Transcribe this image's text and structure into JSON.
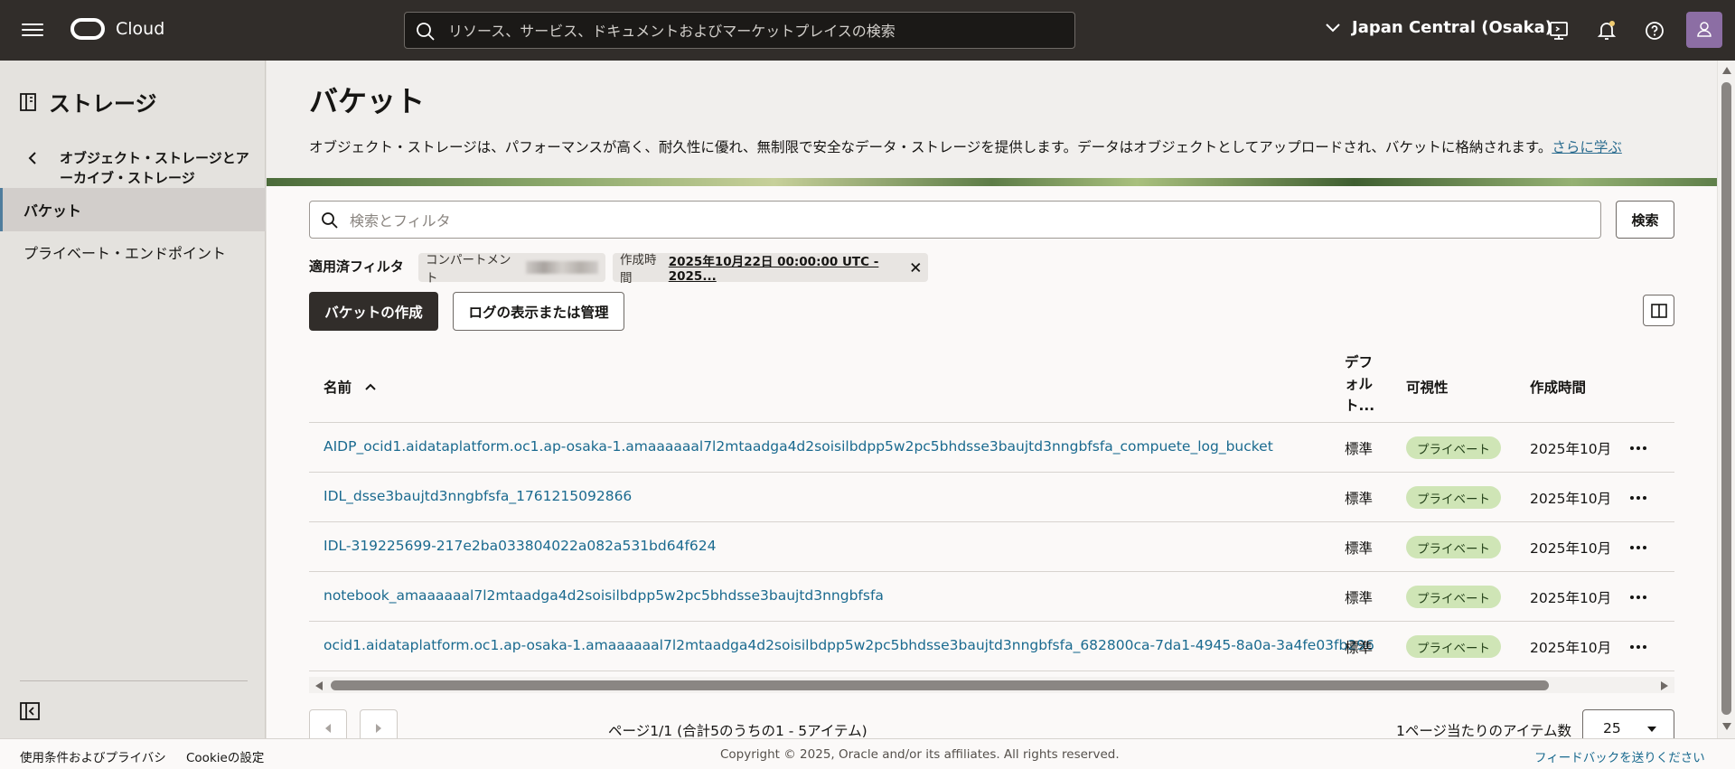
{
  "topbar": {
    "brand": "Cloud",
    "search_placeholder": "リソース、サービス、ドキュメントおよびマーケットプレイスの検索",
    "region": "Japan Central (Osaka)"
  },
  "sidebar": {
    "title": "ストレージ",
    "parent": "オブジェクト・ストレージとアーカイブ・ストレージ",
    "items": [
      {
        "label": "バケット"
      },
      {
        "label": "プライベート・エンドポイント"
      }
    ]
  },
  "main": {
    "title": "バケット",
    "description": "オブジェクト・ストレージは、パフォーマンスが高く、耐久性に優れ、無制限で安全なデータ・ストレージを提供します。データはオブジェクトとしてアップロードされ、バケットに格納されます。",
    "learn_more": "さらに学ぶ",
    "filter_placeholder": "検索とフィルタ",
    "search_button": "検索",
    "applied_filters_label": "適用済フィルタ",
    "chip_compartment_label": "コンパートメント",
    "chip_time_label": "作成時間",
    "chip_time_value": "2025年10月22日 00:00:00 UTC - 2025...",
    "create_button": "バケットの作成",
    "logs_button": "ログの表示または管理"
  },
  "table": {
    "headers": {
      "name": "名前",
      "default_tier": "デフォルト...",
      "visibility": "可視性",
      "created": "作成時間"
    },
    "rows": [
      {
        "name": "AIDP_ocid1.aidataplatform.oc1.ap-osaka-1.amaaaaaal7l2mtaadga4d2soisilbdpp5w2pc5bhdsse3baujtd3nngbfsfa_compuete_log_bucket",
        "tier": "標準",
        "visibility": "プライベート",
        "created": "2025年10月"
      },
      {
        "name": "IDL_dsse3baujtd3nngbfsfa_1761215092866",
        "tier": "標準",
        "visibility": "プライベート",
        "created": "2025年10月"
      },
      {
        "name": "IDL-319225699-217e2ba033804022a082a531bd64f624",
        "tier": "標準",
        "visibility": "プライベート",
        "created": "2025年10月"
      },
      {
        "name": "notebook_amaaaaaal7l2mtaadga4d2soisilbdpp5w2pc5bhdsse3baujtd3nngbfsfa",
        "tier": "標準",
        "visibility": "プライベート",
        "created": "2025年10月"
      },
      {
        "name": "ocid1.aidataplatform.oc1.ap-osaka-1.amaaaaaal7l2mtaadga4d2soisilbdpp5w2pc5bhdsse3baujtd3nngbfsfa_682800ca-7da1-4945-8a0a-3a4fe03fb296",
        "tier": "標準",
        "visibility": "プライベート",
        "created": "2025年10月"
      }
    ]
  },
  "pagination": {
    "info": "ページ1/1 (合計5のうちの1 - 5アイテム)",
    "per_page_label": "1ページ当たりのアイテム数",
    "per_page_value": "25"
  },
  "footer": {
    "terms": "使用条件およびプライバシ",
    "cookies": "Cookieの設定",
    "copyright": "Copyright © 2025, Oracle and/or its affiliates. All rights reserved.",
    "feedback": "フィードバックを送りください"
  }
}
